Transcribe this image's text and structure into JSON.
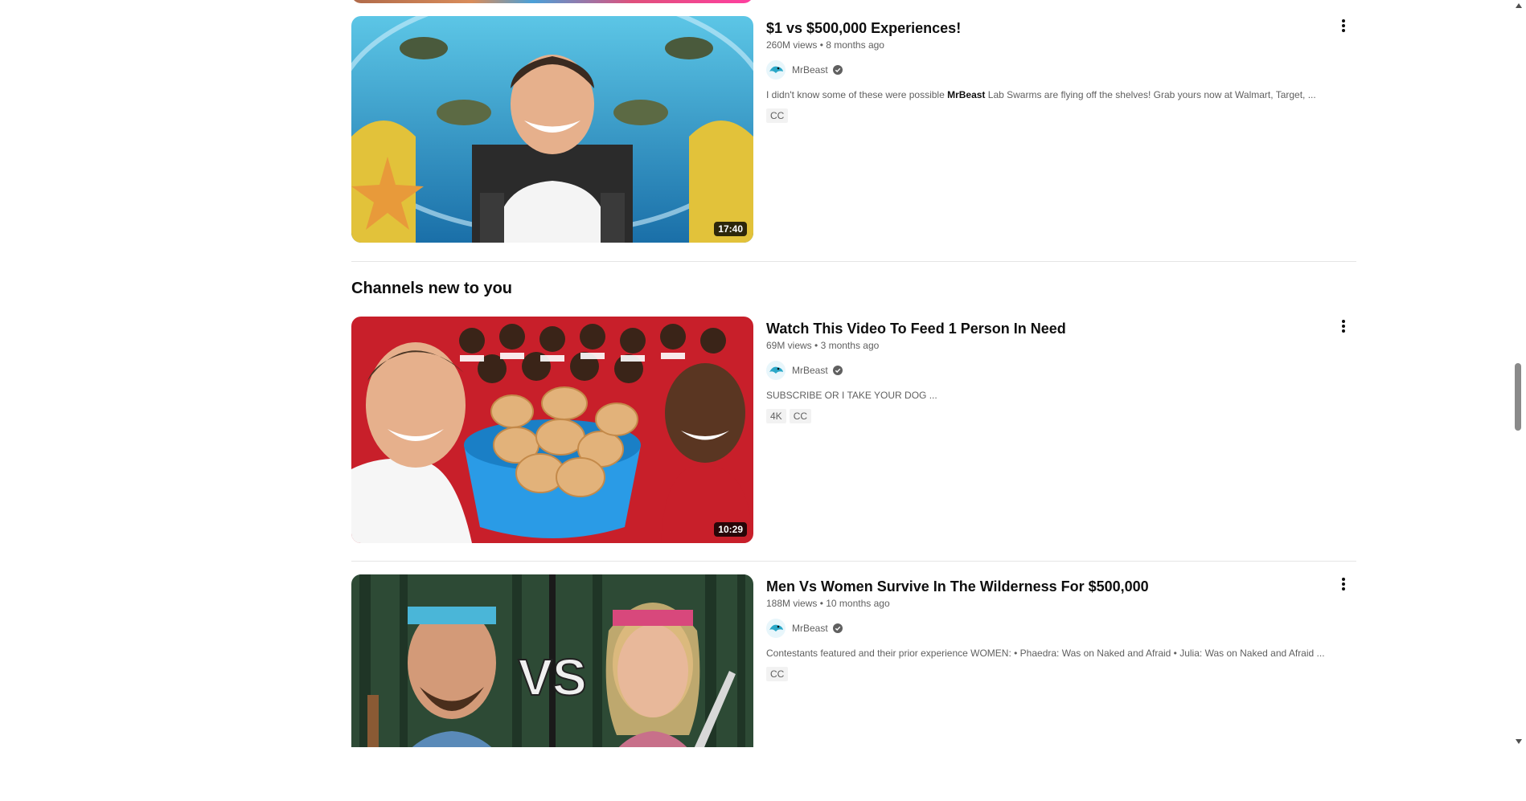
{
  "results": [
    {
      "title": "$1 vs $500,000 Experiences!",
      "views": "260M views",
      "age": "8 months ago",
      "channel": "MrBeast",
      "desc_before": "I didn't know some of these were possible ",
      "desc_bold": "MrBeast",
      "desc_after": " Lab Swarms are flying off the shelves! Grab yours now at Walmart, Target, ...",
      "badges": [
        "CC"
      ],
      "duration": "17:40"
    },
    {
      "title": "Watch This Video To Feed 1 Person In Need",
      "views": "69M views",
      "age": "3 months ago",
      "channel": "MrBeast",
      "desc": "SUBSCRIBE OR I TAKE YOUR DOG ...",
      "badges": [
        "4K",
        "CC"
      ],
      "duration": "10:29"
    },
    {
      "title": "Men Vs Women Survive In The Wilderness For $500,000",
      "views": "188M views",
      "age": "10 months ago",
      "channel": "MrBeast",
      "desc": "Contestants featured and their prior experience WOMEN: • Phaedra: Was on Naked and Afraid • Julia: Was on Naked and Afraid ...",
      "badges": [
        "CC"
      ],
      "duration": ""
    }
  ],
  "section": {
    "title": "Channels new to you"
  },
  "meta_separator": "•",
  "thumb_vs_text": "VS",
  "icons": {
    "more": "more-vert-icon",
    "verified": "verified-check-icon",
    "avatar": "mrbeast-avatar"
  },
  "colors": {
    "text": "#0f0f0f",
    "secondary": "#606060",
    "badge_bg": "#f2f2f2",
    "divider": "#e5e5e5"
  }
}
